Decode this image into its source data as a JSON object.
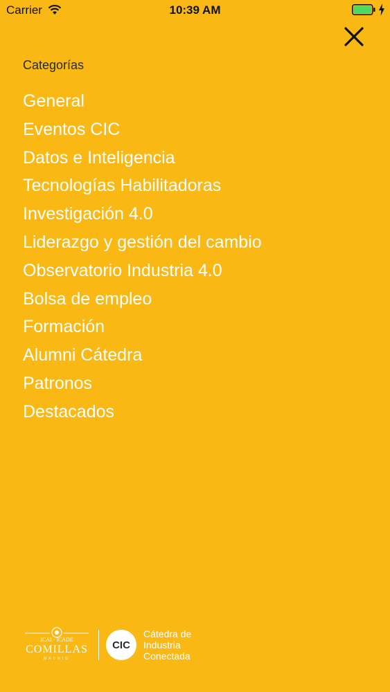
{
  "status_bar": {
    "carrier": "Carrier",
    "time": "10:39 AM",
    "battery_color": "#4CD964"
  },
  "menu": {
    "close_icon": "close-icon",
    "section_label": "Categorías",
    "categories": [
      "General",
      "Eventos CIC",
      "Datos e Inteligencia",
      "Tecnologías Habilitadoras",
      "Investigación 4.0",
      "Liderazgo y gestión del cambio",
      "Observatorio Industria 4.0",
      "Bolsa de empleo",
      "Formación",
      "Alumni Cátedra",
      "Patronos",
      "Destacados"
    ]
  },
  "footer": {
    "comillas_logo_text": "Comillas",
    "comillas_sub": "MADRID",
    "cic_badge": "CIC",
    "cic_line1": "Cátedra de",
    "cic_line2": "Industria",
    "cic_line3": "Conectada"
  },
  "colors": {
    "background": "#F9B814",
    "menu_text": "#FFFFFF",
    "label_text": "#2B2B2B"
  }
}
